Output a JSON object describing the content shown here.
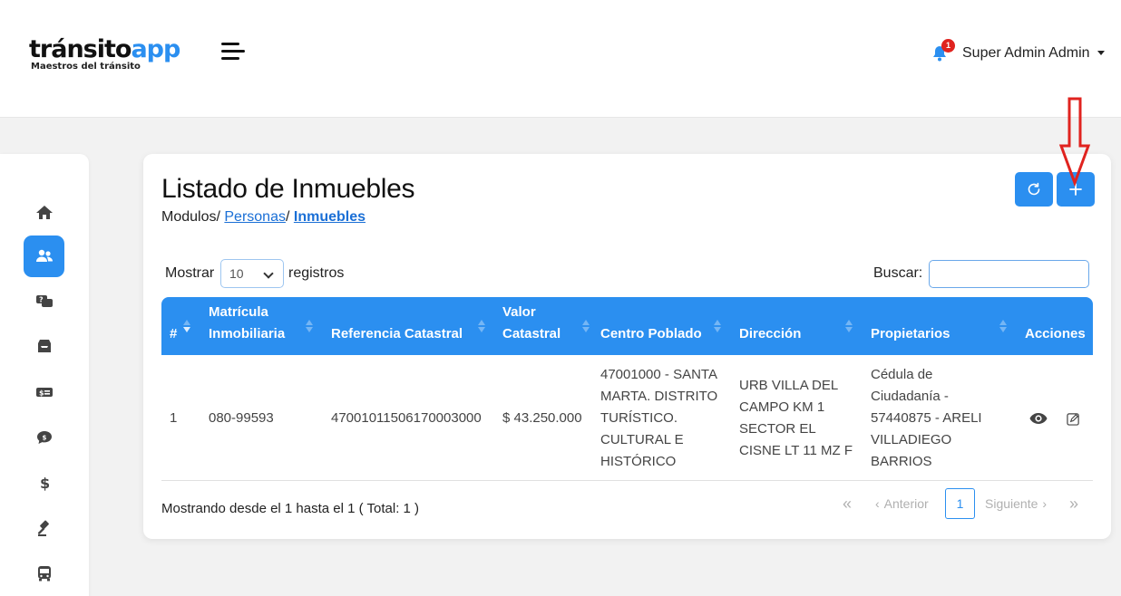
{
  "header": {
    "logo_main": "tránsito",
    "logo_app": "app",
    "logo_sub": "Maestros del tránsito",
    "notification_count": "1",
    "user_name": "Super Admin Admin"
  },
  "sidebar": {
    "items": [
      {
        "icon": "home-icon",
        "active": false
      },
      {
        "icon": "users-icon",
        "active": true
      },
      {
        "icon": "question-chat-icon",
        "active": false
      },
      {
        "icon": "inbox-icon",
        "active": false
      },
      {
        "icon": "money-bill-icon",
        "active": false
      },
      {
        "icon": "comment-dollar-icon",
        "active": false
      },
      {
        "icon": "dollar-icon",
        "active": false
      },
      {
        "icon": "gavel-icon",
        "active": false
      },
      {
        "icon": "bus-icon",
        "active": false
      }
    ]
  },
  "page": {
    "title": "Listado de Inmuebles",
    "breadcrumb_root": "Modulos/",
    "breadcrumb_personas": "Personas",
    "breadcrumb_sep": "/",
    "breadcrumb_current": "Inmuebles"
  },
  "controls": {
    "show_label": "Mostrar",
    "show_value": "10",
    "show_suffix": "registros",
    "search_label": "Buscar:",
    "search_value": ""
  },
  "table": {
    "headers": [
      "#",
      "Matrícula Inmobiliaria",
      "Referencia Catastral",
      "Valor Catastral",
      "Centro Poblado",
      "Dirección",
      "Propietarios",
      "Acciones"
    ],
    "rows": [
      {
        "num": "1",
        "matricula": "080-99593",
        "referencia": "47001011506170003000",
        "valor": "$ 43.250.000",
        "centro": "47001000 - SANTA MARTA. DISTRITO TURÍSTICO. CULTURAL E HISTÓRICO",
        "direccion": "URB VILLA DEL CAMPO KM 1 SECTOR EL CISNE LT 11 MZ F",
        "propietarios": "Cédula de Ciudadanía - 57440875 - ARELI VILLADIEGO BARRIOS"
      }
    ]
  },
  "footer": {
    "info": "Mostrando desde el 1 hasta el 1 ( Total: 1 )",
    "first": "«",
    "prev": "Anterior",
    "page": "1",
    "next": "Siguiente",
    "last": "»"
  },
  "colors": {
    "primary": "#2b8ff0",
    "badge": "#e0231f",
    "annotation": "#e0231f"
  }
}
